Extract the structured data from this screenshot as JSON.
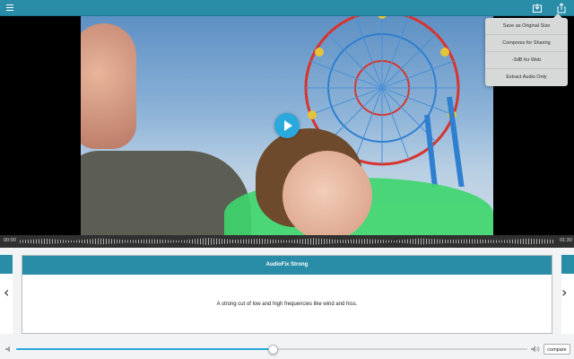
{
  "colors": {
    "accent": "#2a8da8",
    "play": "#2ba9dd"
  },
  "toolbar": {
    "menu_icon": "hamburger-menu-icon",
    "download_icon": "save-to-device-icon",
    "share_icon": "share-icon"
  },
  "export_menu": {
    "items": [
      {
        "label": "Save as Original Size"
      },
      {
        "label": "Compress for Sharing"
      },
      {
        "label": "-3dB for Web"
      },
      {
        "label": "Extract Audio Only"
      }
    ]
  },
  "timeline": {
    "start_time": "00:00",
    "end_time": "01:30"
  },
  "preset": {
    "title": "AudioFix Strong",
    "description": "A strong cut of low and high frequencies like wind and hiss."
  },
  "nav": {
    "prev": "‹",
    "next": "›"
  },
  "volume": {
    "level": 0.5
  },
  "compare_label": "compare"
}
